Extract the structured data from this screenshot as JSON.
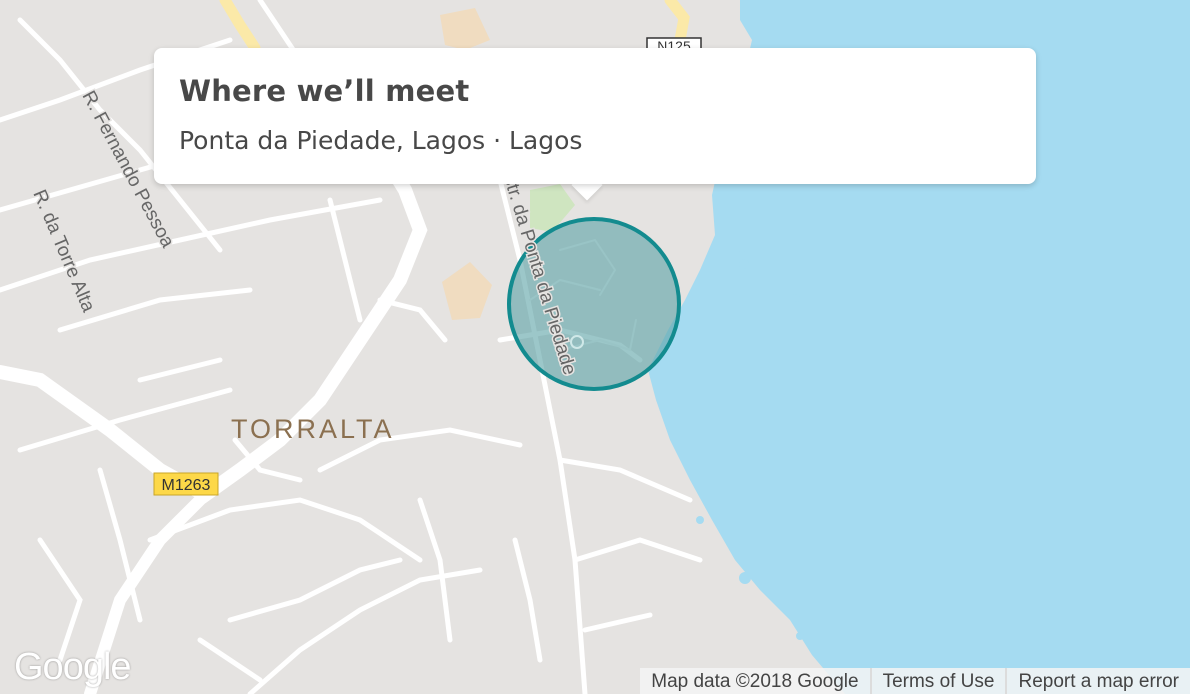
{
  "card": {
    "title": "Where we’ll meet",
    "subtitle": "Ponta da Piedade, Lagos · Lagos"
  },
  "map": {
    "colors": {
      "land": "#e5e3e1",
      "water": "#a5dbf1",
      "road": "#ffffff",
      "highway": "#fbe9a8",
      "park": "#cfe5c0",
      "building": "#f0dcc0",
      "area_circle_fill": "#5fa5a8",
      "area_circle_stroke": "#138b8f"
    },
    "labels": {
      "area": "TORRALTA",
      "street_1": "R. Fernando Pessoa",
      "street_2": "R. da Torre Alta",
      "street_3": "Estr. da Ponta da Piedade",
      "shield_m": "M1263",
      "shield_n": "N125"
    },
    "logo": "Google",
    "attribution": {
      "data": "Map data ©2018 Google",
      "terms": "Terms of Use",
      "report": "Report a map error"
    }
  }
}
